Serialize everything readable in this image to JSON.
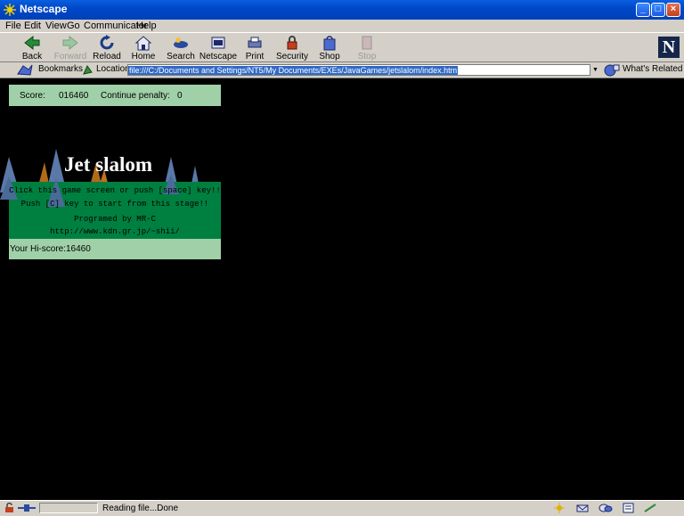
{
  "window": {
    "title": "Netscape"
  },
  "menu": [
    "File",
    "Edit",
    "View",
    "Go",
    "Communicator",
    "Help"
  ],
  "toolbar": {
    "back": "Back",
    "forward": "Forward",
    "reload": "Reload",
    "home": "Home",
    "search": "Search",
    "netscape": "Netscape",
    "print": "Print",
    "security": "Security",
    "shop": "Shop",
    "stop": "Stop"
  },
  "location": {
    "bookmarks": "Bookmarks",
    "label": "Location:",
    "url": "file:///C:/Documents and Settings/NT5/My Documents/EXEs/JavaGames/jetslalom/index.htm",
    "related": "What's Related"
  },
  "game": {
    "score_label": "Score:",
    "score_value": "016460",
    "penalty_label": "Continue penalty:",
    "penalty_value": "0",
    "title": "Jet slalom",
    "line1": "Click this game screen or push [space] key!!",
    "line2": "Push [C] key to start from this stage!!",
    "line3": "Programed by MR-C",
    "line4": "http://www.kdn.gr.jp/~shii/",
    "hiscore": "Your Hi-score:16460"
  },
  "status": {
    "message": "Reading file...Done"
  }
}
